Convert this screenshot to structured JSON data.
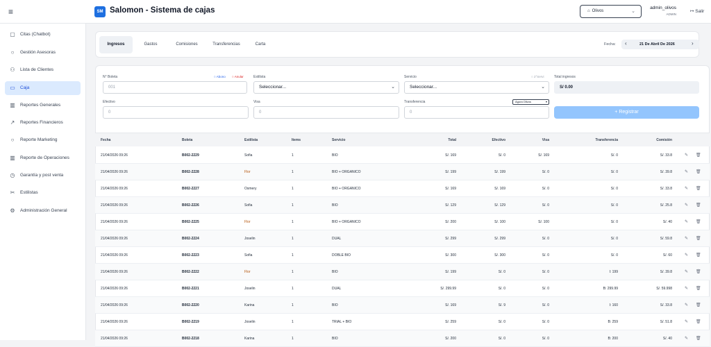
{
  "app": {
    "title": "Salomon - Sistema de cajas",
    "logo": "SM",
    "store": "Olivos",
    "user": "admin_olivos",
    "role": "ADMIN",
    "logout": "Salir",
    "menu_icon": "≡"
  },
  "sidebar": {
    "items": [
      {
        "label": "Citas (Chatbot)",
        "icon": "calendar-icon",
        "glyph": "▢"
      },
      {
        "label": "Gestión Asesoras",
        "icon": "chat-icon",
        "glyph": "○"
      },
      {
        "label": "Lista de Clientes",
        "icon": "users-icon",
        "glyph": "⚇"
      },
      {
        "label": "Caja",
        "icon": "card-icon",
        "glyph": "▭"
      },
      {
        "label": "Reportes Generales",
        "icon": "bar-chart-icon",
        "glyph": "▥"
      },
      {
        "label": "Reportes Financieros",
        "icon": "trend-icon",
        "glyph": "↗"
      },
      {
        "label": "Reporte Marketing",
        "icon": "chat-icon",
        "glyph": "○"
      },
      {
        "label": "Reporte de Operaciones",
        "icon": "bar-chart-icon",
        "glyph": "▥"
      },
      {
        "label": "Garantía y post venta",
        "icon": "clock-icon",
        "glyph": "◷"
      },
      {
        "label": "Estilistas",
        "icon": "scissors-icon",
        "glyph": "✂"
      },
      {
        "label": "Administración General",
        "icon": "gear-icon",
        "glyph": "⚙"
      }
    ]
  },
  "tabs": [
    "Ingresos",
    "Gastos",
    "Comisiones",
    "Transferencias",
    "Carta"
  ],
  "date_nav": {
    "label": "Fecha:",
    "value": "21 De Abril De 2026",
    "prev": "‹",
    "next": "›"
  },
  "form": {
    "boleta_label": "N° Boleta",
    "boleta_placeholder": "001",
    "abono": "Abono",
    "anular": "Anular",
    "estilista_label": "Estilista",
    "estilista_value": "Seleccionar...",
    "servicio_label": "Servicio",
    "servicio_value": "Seleccionar...",
    "servicio_extra": "2°Servi",
    "total_label": "Total ingresos",
    "total_value": "S/ 0.00",
    "efectivo_label": "Efectivo",
    "efectivo_value": "0",
    "visa_label": "Visa",
    "visa_value": "0",
    "transf_label": "Transferencia",
    "transf_value": "0",
    "transf_select": "Agora Olivos",
    "register_label": "+ Registrar"
  },
  "table": {
    "headers": [
      "Fecha",
      "Boleta",
      "Estilista",
      "Items",
      "Servicio",
      "Total",
      "Efectivo",
      "Visa",
      "Transferencia",
      "Comisión"
    ],
    "rows": [
      [
        "21/04/2026 09:26",
        "B002-2229",
        "Sofia",
        "1",
        "BIO",
        "S/. 169",
        "S/. 0",
        "S/. 169",
        "S/. 0",
        "S/. 33.8"
      ],
      [
        "21/04/2026 09:26",
        "B002-2228",
        "Flor",
        "1",
        "BIO + ORGANICO",
        "S/. 199",
        "S/. 199",
        "S/. 0",
        "S/. 0",
        "S/. 39.8"
      ],
      [
        "21/04/2026 09:26",
        "B002-2227",
        "Osmery",
        "1",
        "BIO + ORGANICO",
        "S/. 169",
        "S/. 169",
        "S/. 0",
        "S/. 0",
        "S/. 33.8"
      ],
      [
        "21/04/2026 09:26",
        "B002-2226",
        "Sofia",
        "1",
        "BIO",
        "S/. 129",
        "S/. 129",
        "S/. 0",
        "S/. 0",
        "S/. 25.8"
      ],
      [
        "21/04/2026 09:26",
        "B002-2225",
        "Flor",
        "1",
        "BIO + ORGANICO",
        "S/. 200",
        "S/. 100",
        "S/. 100",
        "S/. 0",
        "S/. 40"
      ],
      [
        "21/04/2026 09:26",
        "B002-2224",
        "Joselin",
        "1",
        "DUAL",
        "S/. 299",
        "S/. 299",
        "S/. 0",
        "S/. 0",
        "S/. 59.8"
      ],
      [
        "21/04/2026 09:26",
        "B002-2223",
        "Sofia",
        "1",
        "DOBLE BIO",
        "S/. 300",
        "S/. 300",
        "S/. 0",
        "S/. 0",
        "S/. 60"
      ],
      [
        "21/04/2026 09:26",
        "B002-2222",
        "Flor",
        "1",
        "BIO",
        "S/. 199",
        "S/. 0",
        "S/. 0",
        "I: 199",
        "S/. 39.8"
      ],
      [
        "21/04/2026 09:26",
        "B002-2221",
        "Joselin",
        "1",
        "DUAL",
        "S/. 299.99",
        "S/. 0",
        "S/. 0",
        "B: 299.99",
        "S/. 59.998"
      ],
      [
        "21/04/2026 09:26",
        "B002-2220",
        "Karina",
        "1",
        "BIO",
        "S/. 169",
        "S/. 9",
        "S/. 0",
        "I: 160",
        "S/. 33.8"
      ],
      [
        "21/04/2026 09:26",
        "B002-2219",
        "Joselin",
        "1",
        "TRIAL + BIO",
        "S/. 259",
        "S/. 0",
        "S/. 0",
        "B: 259",
        "S/. 51.8"
      ],
      [
        "21/04/2026 09:26",
        "B002-2218",
        "Karina",
        "1",
        "BIO",
        "S/. 200",
        "S/. 0",
        "S/. 0",
        "B: 200",
        "S/. 40"
      ]
    ]
  },
  "colors": {
    "accent": "#1e6fe0",
    "active_bg": "#dbeafe",
    "register_btn": "#93c5fd",
    "abono": "#2563eb",
    "anular": "#dc2626",
    "flor_name": "#b45309"
  }
}
